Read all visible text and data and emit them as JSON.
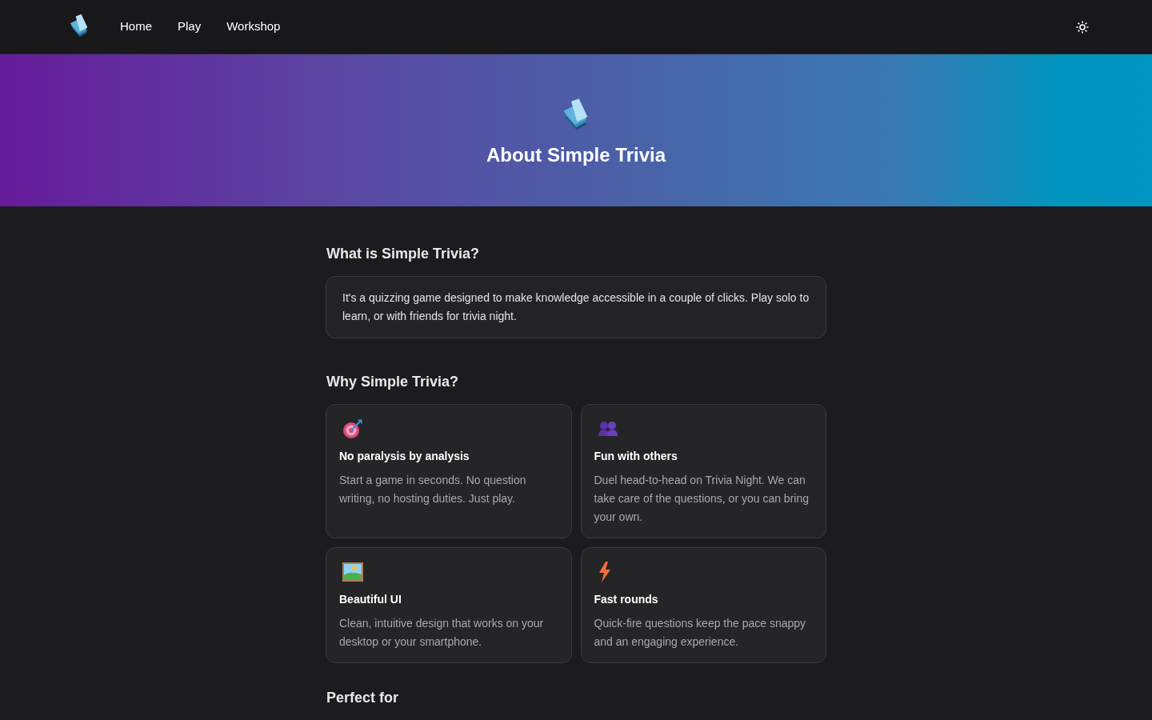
{
  "nav": {
    "links": [
      "Home",
      "Play",
      "Workshop"
    ]
  },
  "hero": {
    "title": "About Simple Trivia"
  },
  "sections": [
    {
      "heading": "What is Simple Trivia?",
      "text": "It's a quizzing game designed to make knowledge accessible in a couple of clicks. Play solo to learn, or with friends for trivia night."
    },
    {
      "heading": "Why Simple Trivia?",
      "features": [
        {
          "kind": "target",
          "title": "No paralysis by analysis",
          "text": "Start a game in seconds. No question writing, no hosting duties. Just play."
        },
        {
          "kind": "people",
          "title": "Fun with others",
          "text": "Duel head-to-head on Trivia Night. We can take care of the questions, or you can bring your own."
        },
        {
          "kind": "landscape",
          "title": "Beautiful UI",
          "text": "Clean, intuitive design that works on your desktop or your smartphone."
        },
        {
          "kind": "bolt",
          "title": "Fast rounds",
          "text": "Quick-fire questions keep the pace snappy and an engaging experience."
        }
      ]
    },
    {
      "heading": "Perfect for"
    }
  ]
}
